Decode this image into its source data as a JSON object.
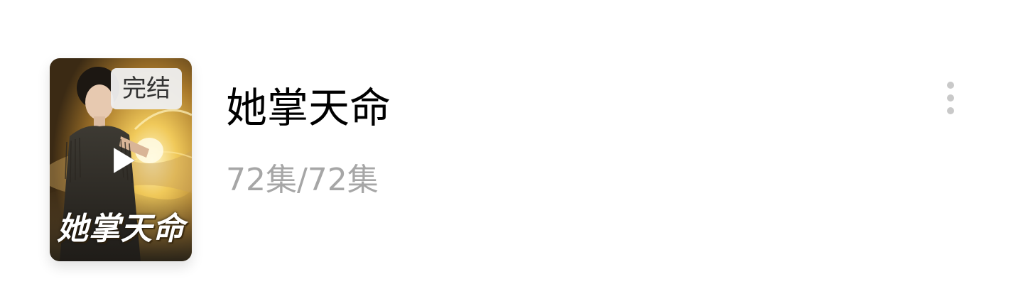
{
  "item": {
    "title": "她掌天命",
    "episodes": "72集/72集",
    "poster": {
      "badge": "完结",
      "title_art": "她掌天命"
    }
  },
  "icons": {
    "play": "play-icon",
    "more": "more-vertical-icon"
  },
  "colors": {
    "title": "#000000",
    "episodes": "#a6a6a6",
    "badge_bg": "#eeeeee",
    "more_dots": "#c9c9c9"
  }
}
